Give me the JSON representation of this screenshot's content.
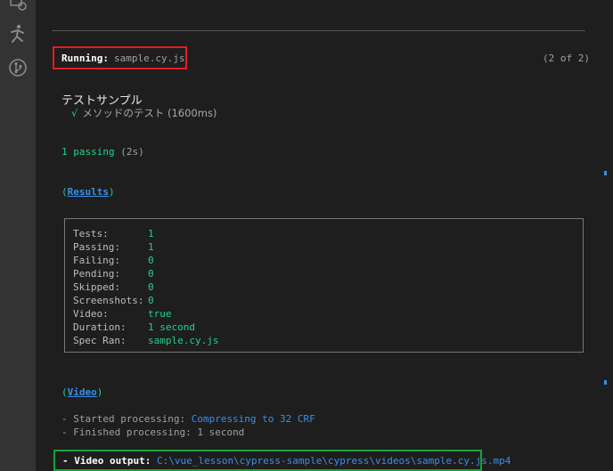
{
  "run_header": {
    "label": "Running:",
    "spec": "sample.cy.js",
    "count": "(2 of 2)"
  },
  "suite": {
    "title": "テストサンプル",
    "check": "√",
    "test_name": "メソッドのテスト",
    "test_duration": "(1600ms)"
  },
  "summary": {
    "passing": "1 passing",
    "duration": "(2s)"
  },
  "results": {
    "heading": "Results",
    "rows": [
      {
        "key": "Tests:",
        "value": "1"
      },
      {
        "key": "Passing:",
        "value": "1"
      },
      {
        "key": "Failing:",
        "value": "0"
      },
      {
        "key": "Pending:",
        "value": "0"
      },
      {
        "key": "Skipped:",
        "value": "0"
      },
      {
        "key": "Screenshots:",
        "value": "0"
      },
      {
        "key": "Video:",
        "value": "true"
      },
      {
        "key": "Duration:",
        "value": "1 second"
      },
      {
        "key": "Spec Ran:",
        "value": "sample.cy.js"
      }
    ]
  },
  "video": {
    "heading": "Video",
    "started_label": "-  Started processing:",
    "started_value": "Compressing to 32 CRF",
    "finished_label": "-  Finished processing:",
    "finished_value": "1 second",
    "output_label": "-  Video output:",
    "output_path": "C:\\vue_lesson\\cypress-sample\\cypress\\videos\\sample.cy.js.mp4"
  },
  "icons": [
    "remote-explorer-icon",
    "run-debug-icon",
    "source-control-icon"
  ],
  "colors": {
    "highlight_red": "#e51c23",
    "highlight_green": "#12a33b",
    "value_green": "#23d18b",
    "link_blue": "#3b8eea"
  }
}
